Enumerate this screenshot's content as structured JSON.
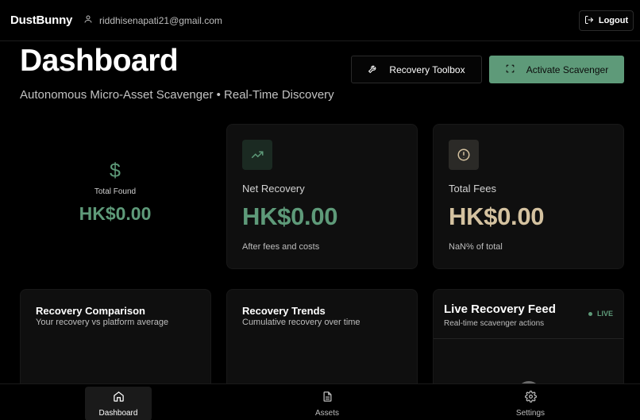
{
  "header": {
    "brand": "DustBunny",
    "user_email": "riddhisenapati21@gmail.com",
    "logout_label": "Logout"
  },
  "page": {
    "title": "Dashboard",
    "subtitle": "Autonomous Micro-Asset Scavenger • Real-Time Discovery",
    "toolbox_label": "Recovery Toolbox",
    "activate_label": "Activate Scavenger"
  },
  "stats": {
    "total_found": {
      "label": "Total Found",
      "value": "HK$0.00",
      "icon": "dollar-icon"
    },
    "net_recovery": {
      "label": "Net Recovery",
      "value": "HK$0.00",
      "sub": "After fees and costs",
      "icon": "trending-up-icon"
    },
    "total_fees": {
      "label": "Total Fees",
      "value": "HK$0.00",
      "sub": "NaN% of total",
      "icon": "alert-circle-icon"
    }
  },
  "panels": {
    "comparison": {
      "title": "Recovery Comparison",
      "subtitle": "Your recovery vs platform average"
    },
    "trends": {
      "title": "Recovery Trends",
      "subtitle": "Cumulative recovery over time"
    },
    "feed": {
      "title": "Live Recovery Feed",
      "subtitle": "Real-time scavenger actions",
      "badge": "LIVE"
    }
  },
  "nav": {
    "items": [
      {
        "label": "Dashboard",
        "icon": "home-icon",
        "active": true
      },
      {
        "label": "Assets",
        "icon": "document-icon",
        "active": false
      },
      {
        "label": "Settings",
        "icon": "gear-icon",
        "active": false
      }
    ]
  },
  "colors": {
    "accent": "#5e9a79",
    "fees": "#d4c2a0",
    "background": "#000000",
    "card": "#0f0f0f"
  }
}
